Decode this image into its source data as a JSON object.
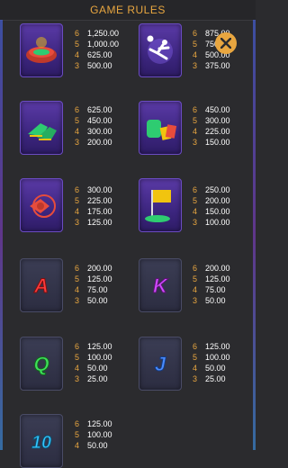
{
  "header": {
    "title": "GAME RULES"
  },
  "close": {
    "icon": "close-icon",
    "color": "#e8a640"
  },
  "paytable": [
    {
      "symbol": "stadium",
      "rows": [
        {
          "count": "6",
          "value": "1,250.00"
        },
        {
          "count": "5",
          "value": "1,000.00"
        },
        {
          "count": "4",
          "value": "625.00"
        },
        {
          "count": "3",
          "value": "500.00"
        }
      ]
    },
    {
      "symbol": "bicycle-kick-player",
      "rows": [
        {
          "count": "6",
          "value": "875.00"
        },
        {
          "count": "5",
          "value": "750.00"
        },
        {
          "count": "4",
          "value": "500.00"
        },
        {
          "count": "3",
          "value": "375.00"
        }
      ]
    },
    {
      "symbol": "football-boots",
      "rows": [
        {
          "count": "6",
          "value": "625.00"
        },
        {
          "count": "5",
          "value": "450.00"
        },
        {
          "count": "4",
          "value": "300.00"
        },
        {
          "count": "3",
          "value": "200.00"
        }
      ]
    },
    {
      "symbol": "goalkeeper-gloves-and-cards",
      "rows": [
        {
          "count": "6",
          "value": "450.00"
        },
        {
          "count": "5",
          "value": "300.00"
        },
        {
          "count": "4",
          "value": "225.00"
        },
        {
          "count": "3",
          "value": "150.00"
        }
      ]
    },
    {
      "symbol": "whistle",
      "rows": [
        {
          "count": "6",
          "value": "300.00"
        },
        {
          "count": "5",
          "value": "225.00"
        },
        {
          "count": "4",
          "value": "175.00"
        },
        {
          "count": "3",
          "value": "125.00"
        }
      ]
    },
    {
      "symbol": "corner-flag",
      "rows": [
        {
          "count": "6",
          "value": "250.00"
        },
        {
          "count": "5",
          "value": "200.00"
        },
        {
          "count": "4",
          "value": "150.00"
        },
        {
          "count": "3",
          "value": "100.00"
        }
      ]
    },
    {
      "symbol": "letter-a",
      "glyph": "A",
      "color": "#ff3b3b",
      "rows": [
        {
          "count": "6",
          "value": "200.00"
        },
        {
          "count": "5",
          "value": "125.00"
        },
        {
          "count": "4",
          "value": "75.00"
        },
        {
          "count": "3",
          "value": "50.00"
        }
      ]
    },
    {
      "symbol": "letter-k",
      "glyph": "K",
      "color": "#d04bff",
      "rows": [
        {
          "count": "6",
          "value": "200.00"
        },
        {
          "count": "5",
          "value": "125.00"
        },
        {
          "count": "4",
          "value": "75.00"
        },
        {
          "count": "3",
          "value": "50.00"
        }
      ]
    },
    {
      "symbol": "letter-q",
      "glyph": "Q",
      "color": "#3fe05a",
      "rows": [
        {
          "count": "6",
          "value": "125.00"
        },
        {
          "count": "5",
          "value": "100.00"
        },
        {
          "count": "4",
          "value": "50.00"
        },
        {
          "count": "3",
          "value": "25.00"
        }
      ]
    },
    {
      "symbol": "letter-j",
      "glyph": "J",
      "color": "#4a8cff",
      "rows": [
        {
          "count": "6",
          "value": "125.00"
        },
        {
          "count": "5",
          "value": "100.00"
        },
        {
          "count": "4",
          "value": "50.00"
        },
        {
          "count": "3",
          "value": "25.00"
        }
      ]
    },
    {
      "symbol": "number-10",
      "glyph": "10",
      "color": "#33c6ff",
      "rows": [
        {
          "count": "6",
          "value": "125.00"
        },
        {
          "count": "5",
          "value": "100.00"
        },
        {
          "count": "4",
          "value": "50.00"
        }
      ]
    }
  ]
}
